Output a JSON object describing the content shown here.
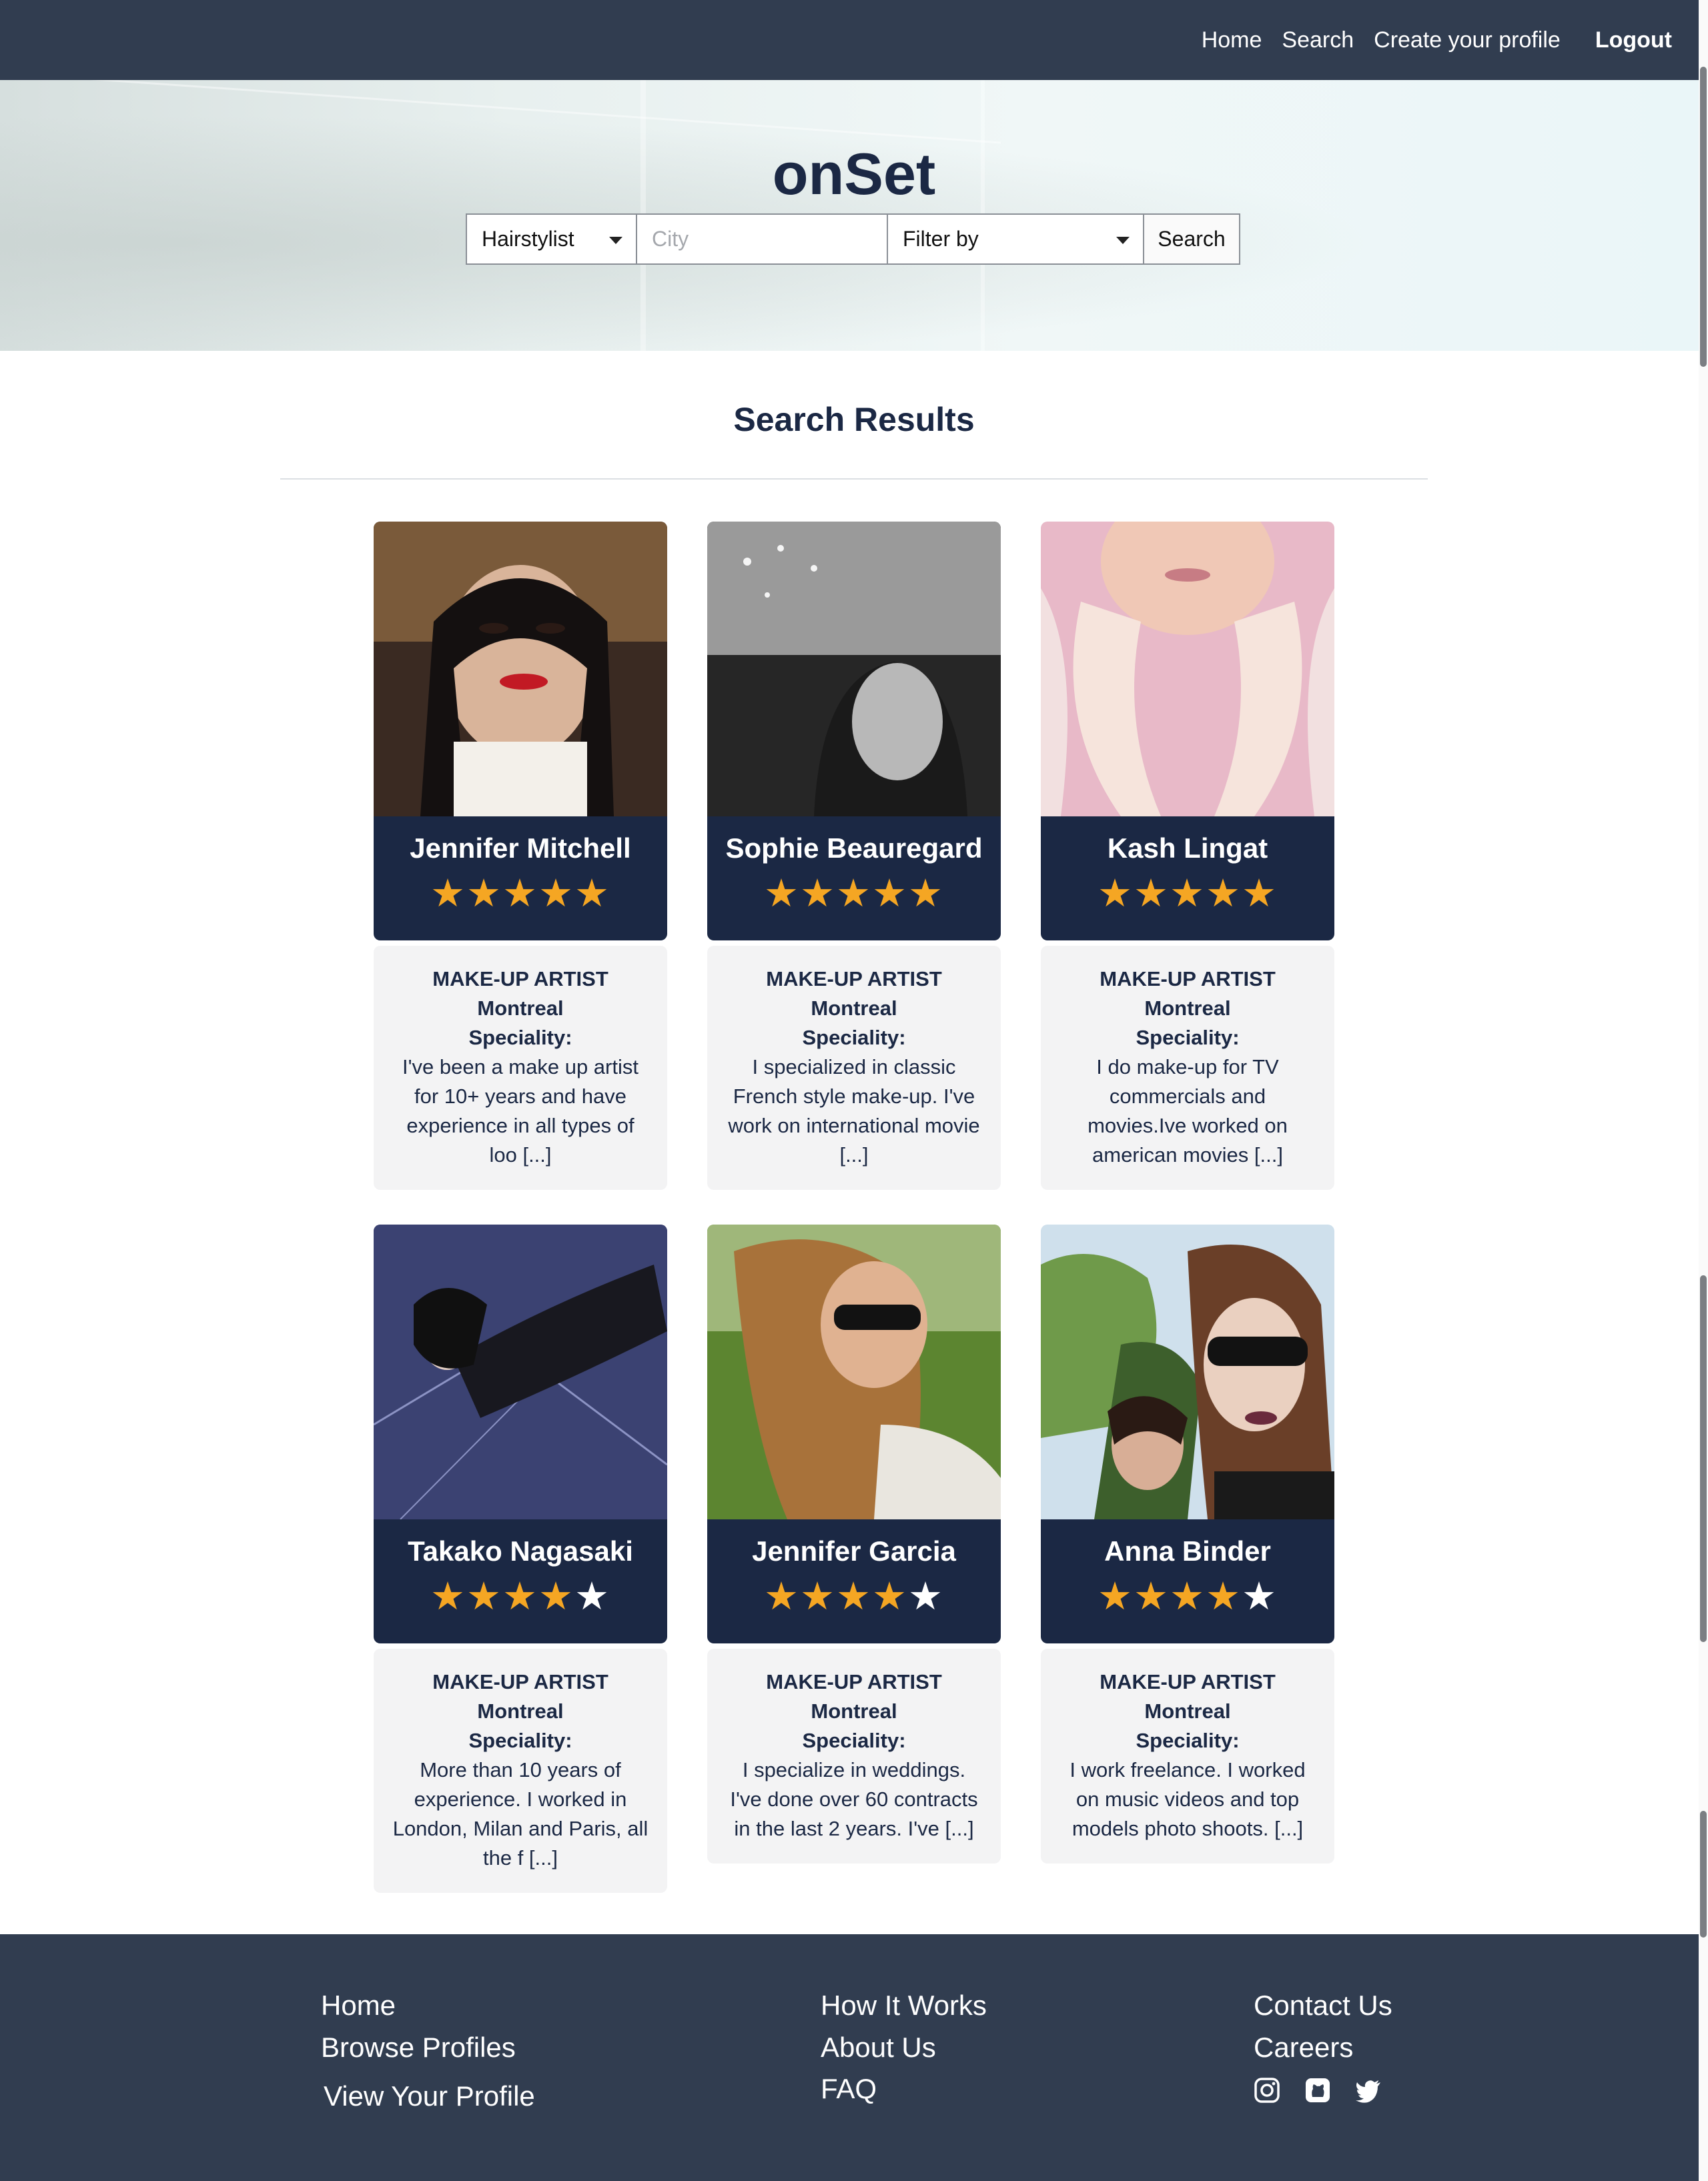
{
  "nav": {
    "home": "Home",
    "search": "Search",
    "create_profile": "Create your profile",
    "logout": "Logout"
  },
  "hero": {
    "title": "onSet",
    "role_select": "Hairstylist",
    "city_placeholder": "City",
    "filter_select": "Filter by",
    "search_button": "Search"
  },
  "results": {
    "title": "Search Results",
    "cards": [
      {
        "name": "Jennifer Mitchell",
        "rating": 5,
        "role": "MAKE-UP ARTIST",
        "city": "Montreal",
        "speciality_label": "Speciality:",
        "description": "I've been a make up artist for 10+ years and have experience in all types of loo [...]"
      },
      {
        "name": "Sophie Beauregard",
        "rating": 5,
        "role": "MAKE-UP ARTIST",
        "city": "Montreal",
        "speciality_label": "Speciality:",
        "description": "I specialized in classic French style make-up. I've work on international movie [...]"
      },
      {
        "name": "Kash Lingat",
        "rating": 5,
        "role": "MAKE-UP ARTIST",
        "city": "Montreal",
        "speciality_label": "Speciality:",
        "description": "I do make-up for TV commercials and movies.Ive worked on american movies [...]"
      },
      {
        "name": "Takako Nagasaki",
        "rating": 4,
        "role": "MAKE-UP ARTIST",
        "city": "Montreal",
        "speciality_label": "Speciality:",
        "description": "More than 10 years of experience. I worked in London, Milan and Paris, all the f [...]"
      },
      {
        "name": "Jennifer Garcia",
        "rating": 4,
        "role": "MAKE-UP ARTIST",
        "city": "Montreal",
        "speciality_label": "Speciality:",
        "description": "I specialize in weddings. I've done over 60 contracts in the last 2 years. I've [...]"
      },
      {
        "name": "Anna Binder",
        "rating": 4,
        "role": "MAKE-UP ARTIST",
        "city": "Montreal",
        "speciality_label": "Speciality:",
        "description": "I work freelance. I worked on music videos and top models photo shoots. [...]"
      }
    ]
  },
  "footer": {
    "home": "Home",
    "browse": "Browse Profiles",
    "view_profile": "View Your Profile",
    "how": "How It Works",
    "about": "About Us",
    "faq": "FAQ",
    "contact": "Contact Us",
    "careers": "Careers",
    "social_icons": [
      "instagram-icon",
      "github-icon",
      "twitter-icon"
    ]
  },
  "colors": {
    "navy": "#1b2844",
    "nav_bg": "#313d50",
    "star": "#f5a623"
  }
}
